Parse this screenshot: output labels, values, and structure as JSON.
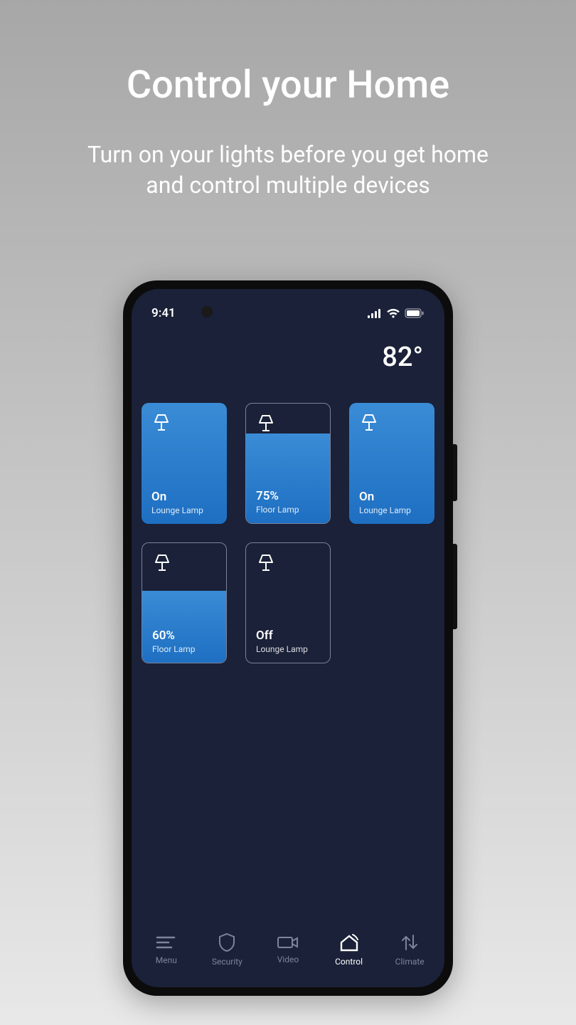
{
  "hero": {
    "title": "Control your Home",
    "subtitle": "Turn on your lights before you get home and control multiple devices"
  },
  "status": {
    "time": "9:41"
  },
  "temperature": "82°",
  "tiles": [
    {
      "state": "On",
      "name": "Lounge Lamp",
      "fill": 100,
      "bordered": false
    },
    {
      "state": "75%",
      "name": "Floor Lamp",
      "fill": 75,
      "bordered": true
    },
    {
      "state": "On",
      "name": "Lounge Lamp",
      "fill": 100,
      "bordered": false
    },
    {
      "state": "60%",
      "name": "Floor Lamp",
      "fill": 60,
      "bordered": true
    },
    {
      "state": "Off",
      "name": "Lounge Lamp",
      "fill": 0,
      "bordered": true
    }
  ],
  "nav": [
    {
      "label": "Menu",
      "icon": "menu",
      "active": false
    },
    {
      "label": "Security",
      "icon": "shield",
      "active": false
    },
    {
      "label": "Video",
      "icon": "camera",
      "active": false
    },
    {
      "label": "Control",
      "icon": "home",
      "active": true
    },
    {
      "label": "Climate",
      "icon": "climate",
      "active": false
    }
  ]
}
